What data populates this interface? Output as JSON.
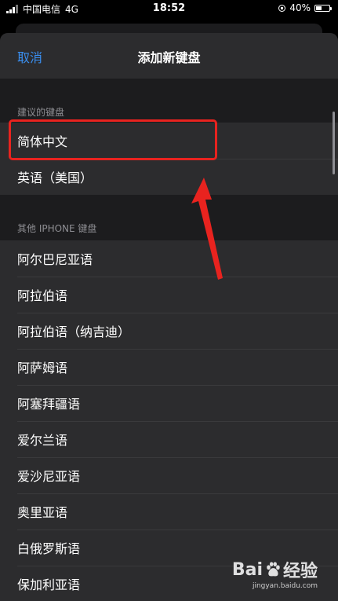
{
  "status_bar": {
    "carrier": "中国电信",
    "network": "4G",
    "time": "18:52",
    "battery": "40%"
  },
  "nav": {
    "cancel_label": "取消",
    "title": "添加新键盘"
  },
  "sections": {
    "suggested": {
      "header": "建议的键盘",
      "items": [
        "简体中文",
        "英语（美国）"
      ]
    },
    "other": {
      "header": "其他 IPHONE 键盘",
      "items": [
        "阿尔巴尼亚语",
        "阿拉伯语",
        "阿拉伯语（纳吉迪）",
        "阿萨姆语",
        "阿塞拜疆语",
        "爱尔兰语",
        "爱沙尼亚语",
        "奥里亚语",
        "白俄罗斯语",
        "保加利亚语"
      ]
    }
  },
  "watermark": {
    "brand": "Bai",
    "brand_suffix": "经验",
    "url": "jingyan.baidu.com"
  },
  "colors": {
    "accent": "#3a8ff0",
    "highlight": "#e8231f",
    "row_bg": "#2c2c2e",
    "sheet_bg": "#1c1c1e"
  }
}
